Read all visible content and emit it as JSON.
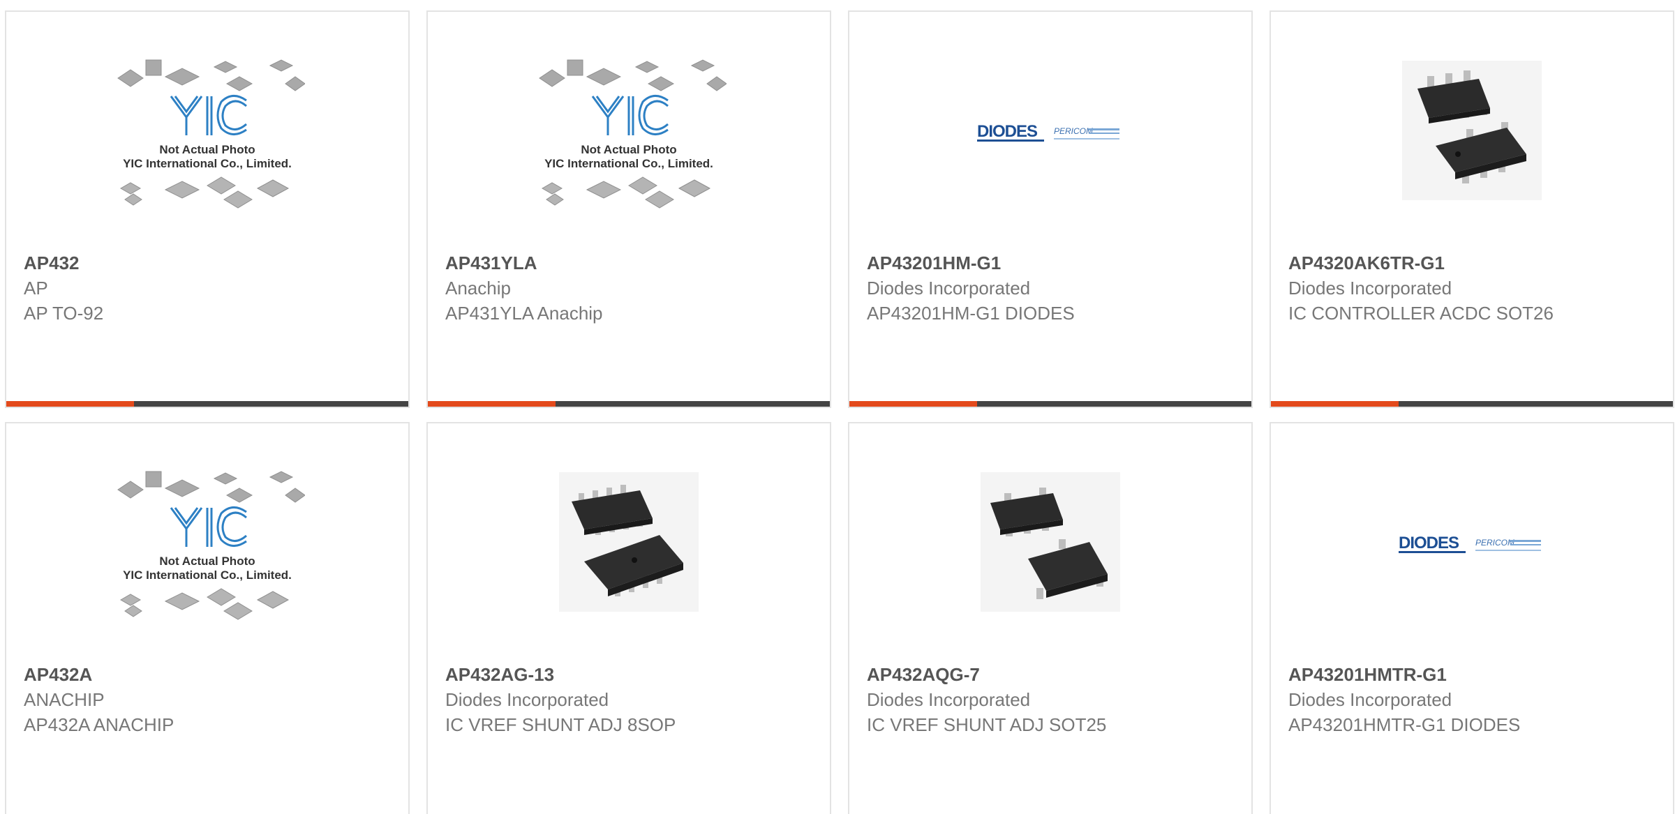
{
  "colors": {
    "accent": "#e34a1c",
    "bar": "#444444",
    "border": "#e3e3e3"
  },
  "placeholder": {
    "logo_text": "YIC",
    "line1": "Not Actual Photo",
    "line2": "YIC International Co., Limited."
  },
  "diodes_logo": {
    "brand": "DIODES",
    "sub": "PERICOM"
  },
  "products": [
    {
      "pn": "AP432",
      "mfr": "AP",
      "desc": "AP TO-92",
      "image": "placeholder-yic"
    },
    {
      "pn": "AP431YLA",
      "mfr": "Anachip",
      "desc": "AP431YLA Anachip",
      "image": "placeholder-yic"
    },
    {
      "pn": "AP43201HM-G1",
      "mfr": "Diodes Incorporated",
      "desc": "AP43201HM-G1 DIODES",
      "image": "diodes-logo"
    },
    {
      "pn": "AP4320AK6TR-G1",
      "mfr": "Diodes Incorporated",
      "desc": "IC CONTROLLER ACDC SOT26",
      "image": "sot-chip"
    },
    {
      "pn": "AP432A",
      "mfr": "ANACHIP",
      "desc": "AP432A ANACHIP",
      "image": "placeholder-yic"
    },
    {
      "pn": "AP432AG-13",
      "mfr": "Diodes Incorporated",
      "desc": "IC VREF SHUNT ADJ 8SOP",
      "image": "sop-chip"
    },
    {
      "pn": "AP432AQG-7",
      "mfr": "Diodes Incorporated",
      "desc": "IC VREF SHUNT ADJ SOT25",
      "image": "sot-chip"
    },
    {
      "pn": "AP43201HMTR-G1",
      "mfr": "Diodes Incorporated",
      "desc": "AP43201HMTR-G1 DIODES",
      "image": "diodes-logo"
    }
  ]
}
